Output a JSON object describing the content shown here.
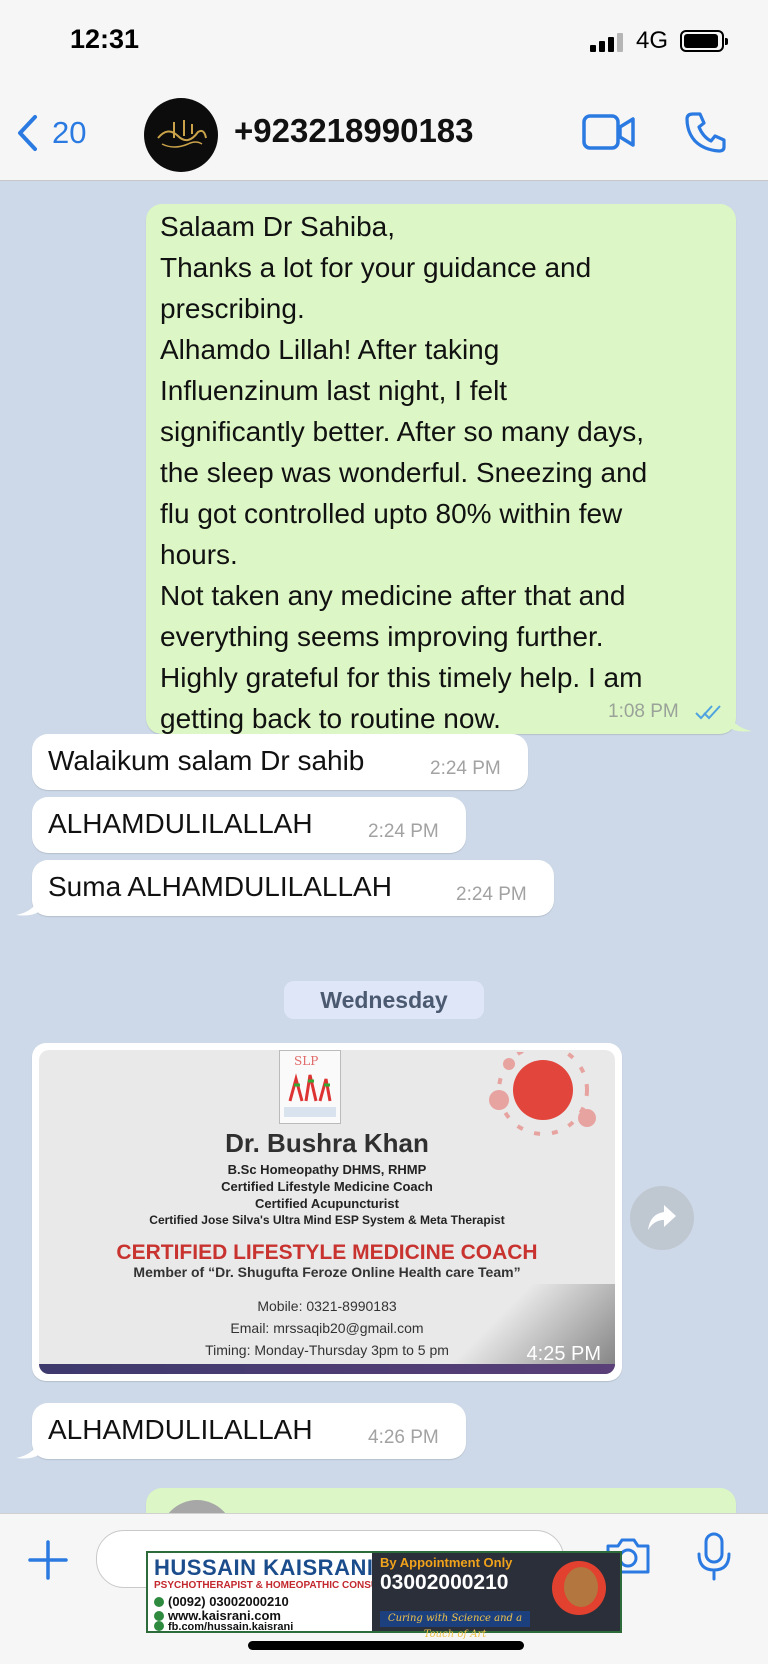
{
  "status": {
    "time": "12:31",
    "network": "4G"
  },
  "header": {
    "back_count": "20",
    "contact_name": "+923218990183"
  },
  "messages": {
    "m1": {
      "lines": [
        "Salaam Dr Sahiba,",
        "Thanks a lot for your guidance and",
        "prescribing.",
        "Alhamdo Lillah! After taking",
        "Influenzinum last night, I felt",
        "significantly better. After so many days,",
        "the sleep was wonderful. Sneezing and",
        "flu got controlled upto 80% within few",
        "hours.",
        "Not taken any medicine after that and",
        "everything seems improving further.",
        "Highly grateful for this timely help. I am",
        "getting back to routine now."
      ],
      "time": "1:08 PM"
    },
    "m2": {
      "text": "Walaikum salam Dr sahib",
      "time": "2:24 PM"
    },
    "m3": {
      "text": "ALHAMDULILALLAH",
      "time": "2:24 PM"
    },
    "m4": {
      "text": "Suma ALHAMDULILALLAH",
      "time": "2:24 PM"
    },
    "day": "Wednesday",
    "image": {
      "time": "4:25 PM",
      "card": {
        "name": "Dr. Bushra Khan",
        "lines": [
          "B.Sc Homeopathy DHMS, RHMP",
          "Certified Lifestyle Medicine Coach",
          "Certified Acupuncturist",
          "Certified Jose Silva's Ultra Mind ESP System & Meta Therapist"
        ],
        "headline": "CERTIFIED LIFESTYLE MEDICINE COACH",
        "member": "Member of “Dr. Shugufta Feroze Online Health care Team”",
        "mobile": "Mobile: 0321-8990183",
        "email": "Email: mrssaqib20@gmail.com",
        "timing": "Timing: Monday-Thursday 3pm to 5 pm"
      }
    },
    "m5": {
      "text": "ALHAMDULILALLAH",
      "time": "4:26 PM"
    }
  },
  "ad": {
    "name": "HUSSAIN KAISRANI",
    "role": "PSYCHOTHERAPIST & HOMEOPATHIC CONSULTANT",
    "phone_line": "(0092) 03002000210",
    "web": "www.kaisrani.com",
    "fb": "fb.com/hussain.kaisrani",
    "appointment": "By Appointment Only",
    "phone_big": "03002000210",
    "tagline": "Curing with Science and a Touch of Art"
  },
  "colors": {
    "accent": "#2a7ae2",
    "outgoing_bubble": "#dcf7c5",
    "chat_background": "#cdd9e8",
    "ticks": "#4fa3e0"
  }
}
